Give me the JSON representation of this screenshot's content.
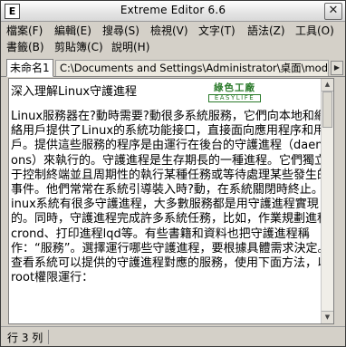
{
  "window": {
    "title": "Extreme Editor 6.6"
  },
  "menu": {
    "row1": [
      "檔案(F)",
      "編輯(E)",
      "搜尋(S)",
      "檢視(V)",
      "文字(T)",
      "語法(Z)",
      "工具(O)"
    ],
    "row2": [
      "書籤(B)",
      "剪貼簿(C)",
      "說明(H)"
    ]
  },
  "tabs": {
    "active": "未命名1",
    "doc_path": "C:\\Documents and Settings\\Administrator\\桌面\\mod_cban"
  },
  "editor": {
    "doc_title": "深入理解Linux守護進程",
    "logo_cn": "綠色工廠",
    "logo_en": "EASYLIFE",
    "body": "Linux服務器在?動時需要?動很多系統服務，它們向本地和網絡用戶提供了Linux的系統功能接口，直接面向應用程序和用戶。提供這些服務的程序是由運行在後台的守護進程（daemons）來執行的。守護進程是生存期長的一種進程。它們獨立于控制終端並且周期性的執行某種任務或等待處理某些發生的事件。他們常常在系統引導裝入時?動，在系統關閉時終止。linux系統有很多守護進程，大多數服務都是用守護進程實現的。同時，守護進程完成許多系統任務，比如，作業規劃進程crond、打印進程lqd等。有些書籍和資料也把守護進程稱作：“服務”。選擇運行哪些守護進程，要根據具體需求決定。查看系統可以提供的守護進程對應的服務，使用下面方法，以root權限運行："
  },
  "status": {
    "position": "行 3 列"
  }
}
